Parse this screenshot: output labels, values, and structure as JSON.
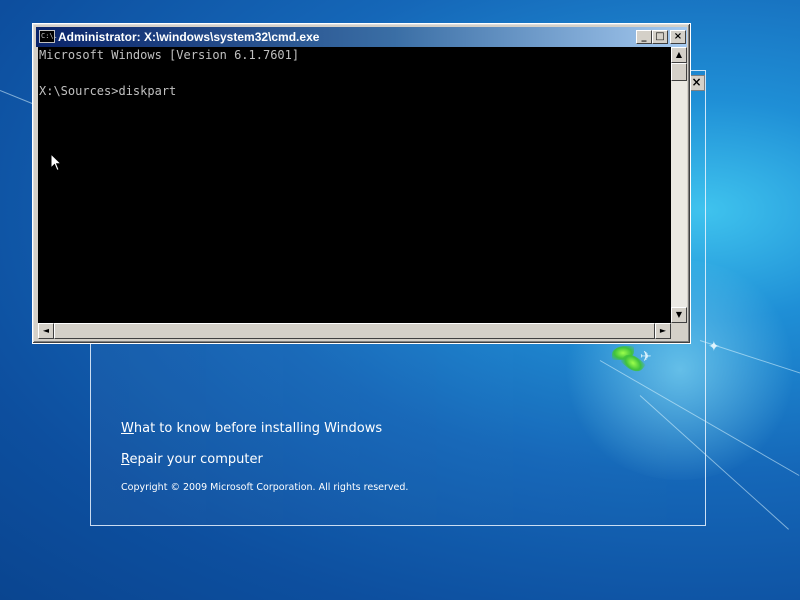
{
  "cmd_window": {
    "title": "Administrator: X:\\windows\\system32\\cmd.exe",
    "sys_icon_label": "C:\\.",
    "buttons": {
      "minimize": "_",
      "maximize": "□",
      "close": "×"
    },
    "console_lines": [
      "Microsoft Windows [Version 6.1.7601]",
      "",
      "X:\\Sources>diskpart"
    ],
    "scroll_arrows": {
      "up": "▲",
      "down": "▼",
      "left": "◄",
      "right": "►"
    }
  },
  "setup_window": {
    "close_label": "×",
    "links": [
      {
        "accel": "W",
        "rest": "hat to know before installing Windows"
      },
      {
        "accel": "R",
        "rest": "epair your computer"
      }
    ],
    "copyright": "Copyright © 2009 Microsoft Corporation. All rights reserved."
  },
  "icons": {
    "pointer": "mouse-pointer-icon",
    "leaf": "leaf-icon",
    "bird": "bird-icon"
  },
  "colors": {
    "desktop_blue": "#1567b8",
    "console_bg": "#000000",
    "console_text": "#c0c0c0",
    "titlebar_start": "#0a246a",
    "titlebar_end": "#a6caf0"
  }
}
